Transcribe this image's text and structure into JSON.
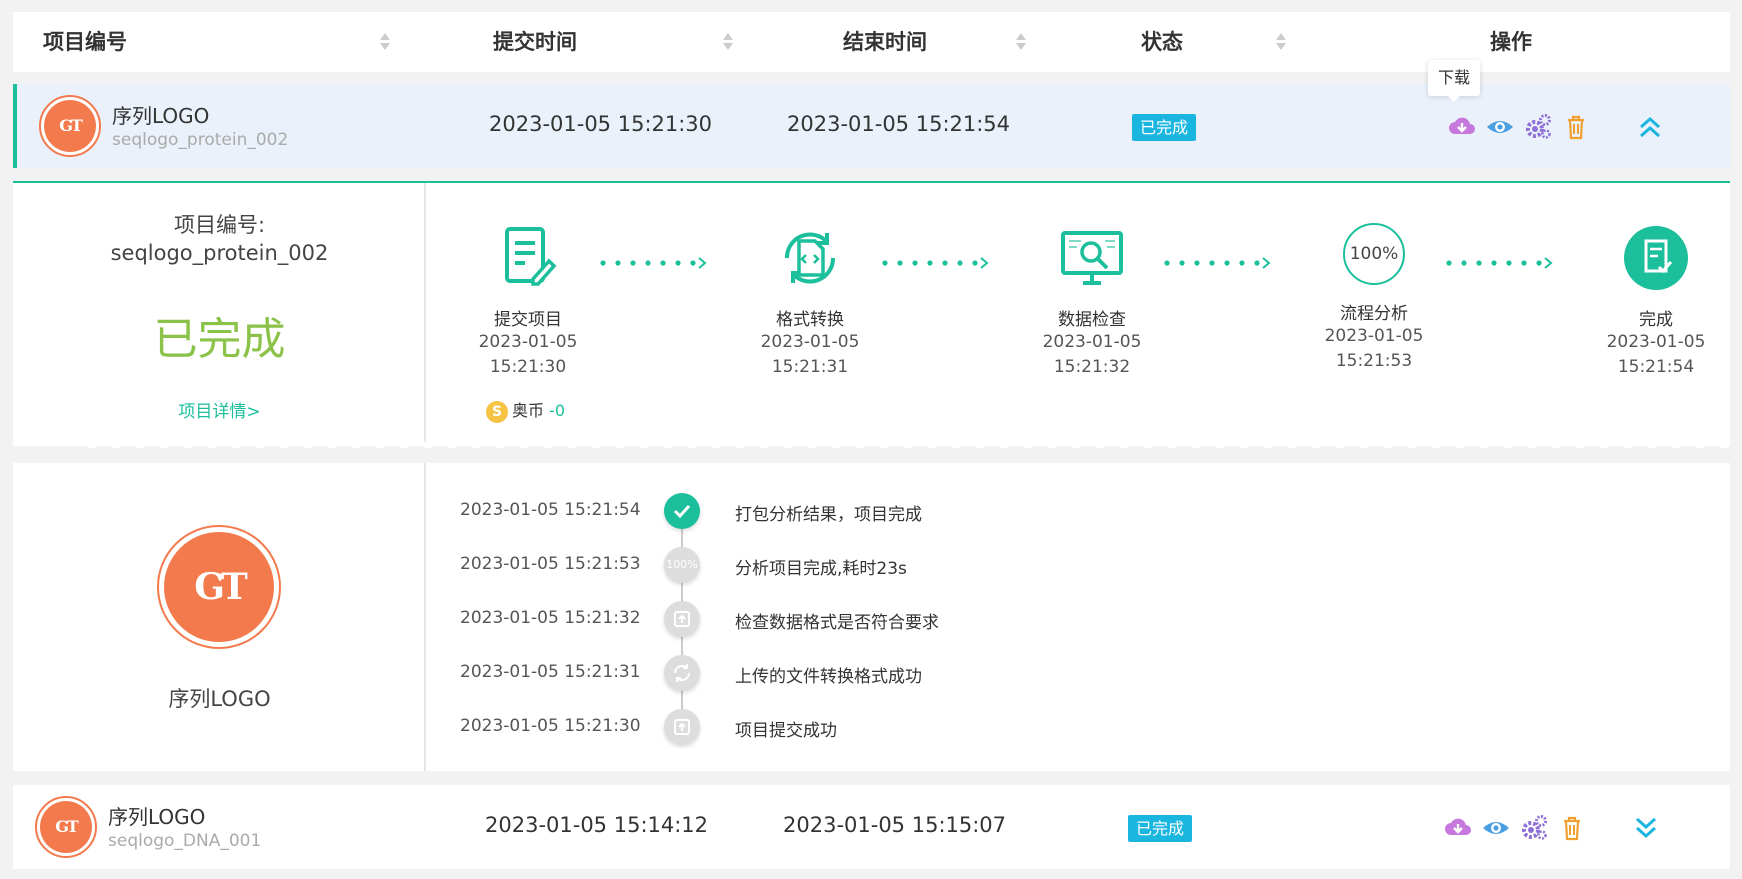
{
  "header": {
    "col_id": "项目编号",
    "col_submit": "提交时间",
    "col_end": "结束时间",
    "col_status": "状态",
    "col_ops": "操作"
  },
  "rows": [
    {
      "name": "序列LOGO",
      "id": "seqlogo_protein_002",
      "submit": "2023-01-05 15:21:30",
      "end": "2023-01-05 15:21:54",
      "status": "已完成"
    },
    {
      "name": "序列LOGO",
      "id": "seqlogo_DNA_001",
      "submit": "2023-01-05 15:14:12",
      "end": "2023-01-05 15:15:07",
      "status": "已完成"
    }
  ],
  "tooltip": "下载",
  "detail": {
    "label": "项目编号:",
    "value": "seqlogo_protein_002",
    "status": "已完成",
    "link": "项目详情>",
    "coin_label": "奥币",
    "coin_value": "-0",
    "steps": [
      {
        "label": "提交项目",
        "date": "2023-01-05",
        "time": "15:21:30",
        "icon": "document-edit-icon"
      },
      {
        "label": "格式转换",
        "date": "2023-01-05",
        "time": "15:21:31",
        "icon": "file-convert-icon"
      },
      {
        "label": "数据检查",
        "date": "2023-01-05",
        "time": "15:21:32",
        "icon": "monitor-search-icon"
      },
      {
        "label": "流程分析",
        "date": "2023-01-05",
        "time": "15:21:53",
        "icon": "percent-circle-icon",
        "icon_text": "100%"
      },
      {
        "label": "完成",
        "date": "2023-01-05",
        "time": "15:21:54",
        "icon": "done-document-icon"
      }
    ]
  },
  "log": {
    "logo_text": "GT",
    "name": "序列LOGO",
    "items": [
      {
        "time": "2023-01-05 15:21:54",
        "msg": "打包分析结果，项目完成",
        "icon": "check-icon"
      },
      {
        "time": "2023-01-05 15:21:53",
        "msg": "分析项目完成,耗时23s",
        "icon": "percent-icon",
        "icon_text": "100%"
      },
      {
        "time": "2023-01-05 15:21:32",
        "msg": "检查数据格式是否符合要求",
        "icon": "upload-icon"
      },
      {
        "time": "2023-01-05 15:21:31",
        "msg": "上传的文件转换格式成功",
        "icon": "refresh-icon"
      },
      {
        "time": "2023-01-05 15:21:30",
        "msg": "项目提交成功",
        "icon": "upload-icon"
      }
    ]
  },
  "logo_small_text": "GT",
  "colors": {
    "accent": "#1cbf9c",
    "badge": "#1bb6e0",
    "logo": "#f37a4c",
    "done_text": "#8bc34a",
    "download": "#c678dd",
    "view": "#4a9fe0",
    "settings": "#8e6fd6",
    "delete": "#f0a030"
  }
}
